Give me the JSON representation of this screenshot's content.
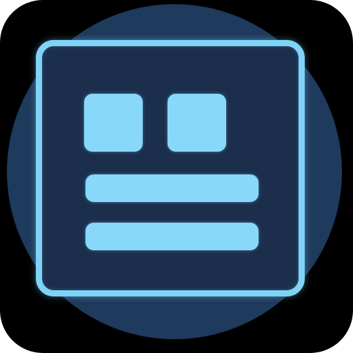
{
  "app_icon": {
    "icon": "dashboard-layout-icon",
    "colors": {
      "tile_background": "#000000",
      "circle": "#1e3a5c",
      "panel_fill": "#1b2f4d",
      "accent": "#7fd3f7"
    }
  }
}
